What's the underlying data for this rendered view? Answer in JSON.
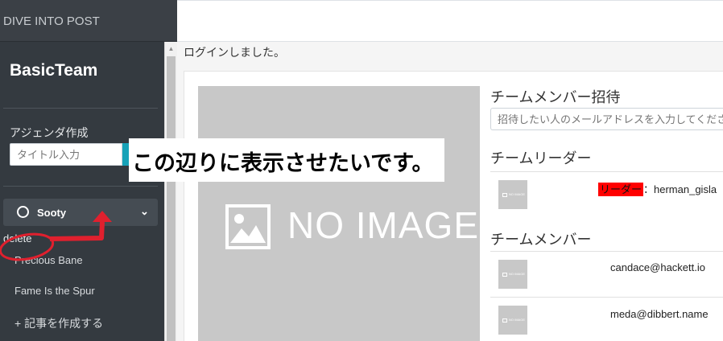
{
  "app": {
    "brand": "DIVE INTO POST"
  },
  "sidebar": {
    "team_name": "BasicTeam",
    "agenda_label": "アジェンダ作成",
    "agenda_placeholder": "タイトル入力",
    "channel_label": "Sooty",
    "delete_label": "delete",
    "items": [
      {
        "label": "Precious Bane"
      },
      {
        "label": "Fame Is the Spur"
      },
      {
        "label": "+ 記事を作成する"
      }
    ]
  },
  "main": {
    "flash": "ログインしました。",
    "image_text": "NO IMAGE",
    "invite": {
      "title": "チームメンバー招待",
      "placeholder": "招待したい人のメールアドレスを入力してください"
    },
    "leader": {
      "title": "チームリーダー",
      "badge": "リーダー",
      "name": "：herman_gisla"
    },
    "members": {
      "title": "チームメンバー",
      "emails": [
        "candace@hackett.io",
        "meda@dibbert.name"
      ]
    },
    "thumb_text": "NO IMAGE"
  },
  "annotation": {
    "note": "この辺りに表示させたいです。",
    "color": "#e0202e"
  },
  "icons": {
    "brand_bar": "scroll-up-icon",
    "image": "image-placeholder-icon",
    "channel": "circle-icon",
    "chevron": "chevron-down-icon"
  }
}
